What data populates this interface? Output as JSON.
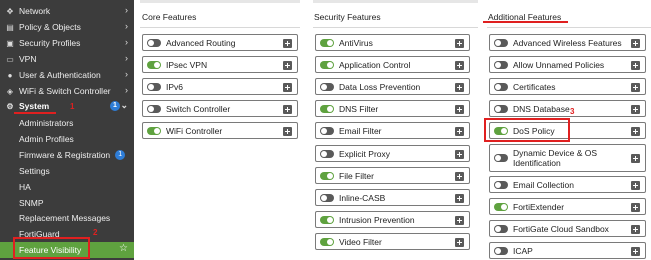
{
  "sidebar": {
    "items": [
      {
        "label": "Network",
        "icon": "network-icon",
        "glyph": "✥",
        "chevron": "›"
      },
      {
        "label": "Policy & Objects",
        "icon": "policy-icon",
        "glyph": "▤",
        "chevron": "›"
      },
      {
        "label": "Security Profiles",
        "icon": "lock-icon",
        "glyph": "▣",
        "chevron": "›"
      },
      {
        "label": "VPN",
        "icon": "monitor-icon",
        "glyph": "▭",
        "chevron": "›"
      },
      {
        "label": "User & Authentication",
        "icon": "user-icon",
        "glyph": "●",
        "chevron": "›"
      },
      {
        "label": "WiFi & Switch Controller",
        "icon": "wifi-icon",
        "glyph": "◈",
        "chevron": "›"
      }
    ],
    "system": {
      "label": "System",
      "badge": "1",
      "icon": "gear-icon",
      "glyph": "⚙",
      "chevron": "⌄"
    },
    "subitems": [
      {
        "label": "Administrators",
        "badge": ""
      },
      {
        "label": "Admin Profiles",
        "badge": ""
      },
      {
        "label": "Firmware & Registration",
        "badge": "1"
      },
      {
        "label": "Settings",
        "badge": ""
      },
      {
        "label": "HA",
        "badge": ""
      },
      {
        "label": "SNMP",
        "badge": ""
      },
      {
        "label": "Replacement Messages",
        "badge": ""
      },
      {
        "label": "FortiGuard",
        "badge": ""
      }
    ],
    "active": {
      "label": "Feature Visibility",
      "star": "☆"
    }
  },
  "annotations": {
    "n1": "1",
    "n2": "2",
    "n3": "3",
    "color": "#e02020"
  },
  "columns": [
    {
      "title": "Core Features",
      "features": [
        {
          "label": "Advanced Routing",
          "on": false
        },
        {
          "label": "IPsec VPN",
          "on": true
        },
        {
          "label": "IPv6",
          "on": false
        },
        {
          "label": "Switch Controller",
          "on": false
        },
        {
          "label": "WiFi Controller",
          "on": true
        }
      ]
    },
    {
      "title": "Security Features",
      "features": [
        {
          "label": "AntiVirus",
          "on": true
        },
        {
          "label": "Application Control",
          "on": true
        },
        {
          "label": "Data Loss Prevention",
          "on": false
        },
        {
          "label": "DNS Filter",
          "on": true
        },
        {
          "label": "Email Filter",
          "on": false
        },
        {
          "label": "Explicit Proxy",
          "on": false
        },
        {
          "label": "File Filter",
          "on": true
        },
        {
          "label": "Inline-CASB",
          "on": false
        },
        {
          "label": "Intrusion Prevention",
          "on": true
        },
        {
          "label": "Video Filter",
          "on": true
        }
      ]
    },
    {
      "title": "Additional Features",
      "features": [
        {
          "label": "Advanced Wireless Features",
          "on": false
        },
        {
          "label": "Allow Unnamed Policies",
          "on": false
        },
        {
          "label": "Certificates",
          "on": false
        },
        {
          "label": "DNS Database",
          "on": false
        },
        {
          "label": "DoS Policy",
          "on": true
        },
        {
          "label": "Dynamic Device & OS Identification",
          "on": false
        },
        {
          "label": "Email Collection",
          "on": false
        },
        {
          "label": "FortiExtender",
          "on": true
        },
        {
          "label": "FortiGate Cloud Sandbox",
          "on": false
        },
        {
          "label": "ICAP",
          "on": false
        }
      ]
    }
  ],
  "colors": {
    "sidebar_bg": "#3c3c3c",
    "accent_green": "#5fa23f",
    "badge_blue": "#2e7dd7",
    "toggle_off": "#5a5a5a"
  }
}
